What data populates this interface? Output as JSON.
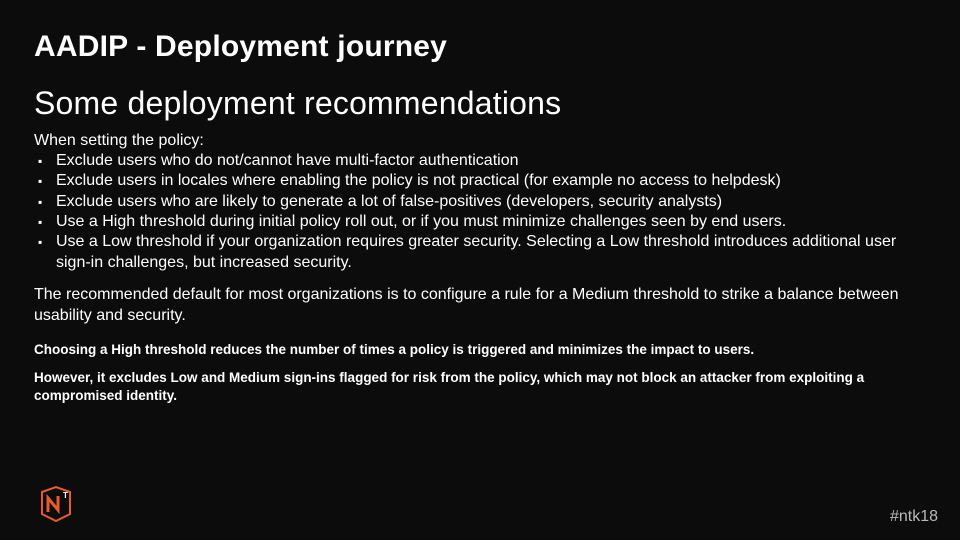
{
  "title": "AADIP - Deployment journey",
  "subtitle": "Some deployment recommendations",
  "lead": "When setting the policy:",
  "bullets": [
    "Exclude users who do not/cannot have multi-factor authentication",
    "Exclude users in locales where enabling the policy is not practical (for example no access to helpdesk)",
    "Exclude users who are likely to generate a lot of false-positives (developers, security analysts)",
    "Use a High threshold during initial policy roll out, or if you must minimize challenges seen by end users.",
    "Use a Low threshold if your organization requires greater security. Selecting a Low threshold introduces additional user sign-in challenges, but increased security."
  ],
  "para1": "The recommended default for most organizations is to configure a rule for a Medium threshold to strike a balance between usability and security.",
  "small1": "Choosing a High threshold reduces the number of times a policy is triggered and minimizes the impact to users.",
  "small2": "However, it excludes Low and Medium sign-ins flagged for risk from the policy, which may not block an attacker from exploiting a compromised identity.",
  "hashtag": "#ntk18"
}
